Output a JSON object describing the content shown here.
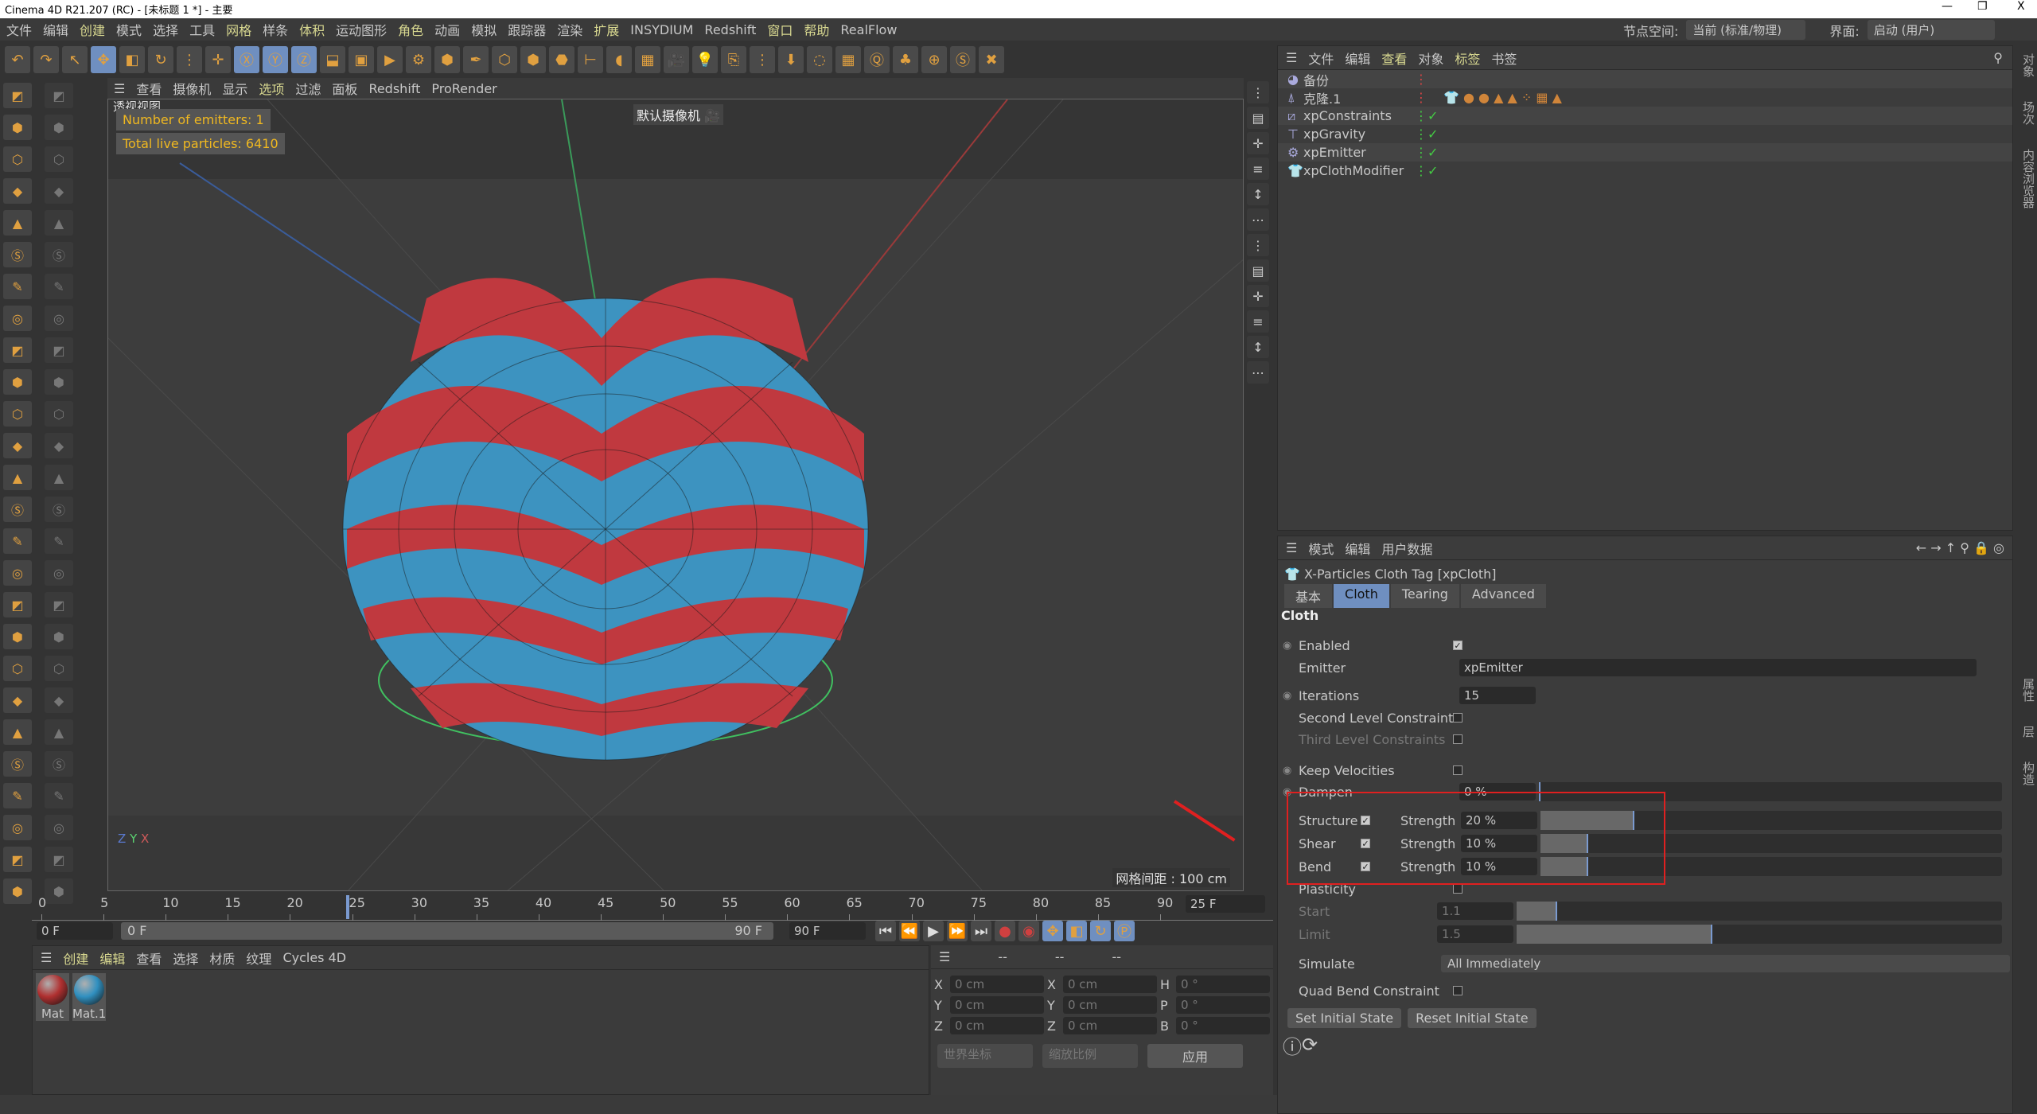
{
  "window": {
    "title": "Cinema 4D R21.207 (RC) - [未标题 1 *] - 主要",
    "minimize": "—",
    "maximize": "❐",
    "close": "X"
  },
  "menu": [
    "文件",
    "编辑",
    "创建",
    "模式",
    "选择",
    "工具",
    "网格",
    "样条",
    "体积",
    "运动图形",
    "角色",
    "动画",
    "模拟",
    "跟踪器",
    "渲染",
    "扩展",
    "INSYDIUM",
    "Redshift",
    "窗口",
    "帮助",
    "RealFlow"
  ],
  "node_space": {
    "label": "节点空间:",
    "value": "当前 (标准/物理)"
  },
  "layout": {
    "label": "界面:",
    "value": "启动 (用户)"
  },
  "viewport": {
    "menu": [
      "查看",
      "摄像机",
      "显示",
      "选项",
      "过滤",
      "面板",
      "Redshift",
      "ProRender"
    ],
    "view_name": "透视视图",
    "camera": "默认摄像机",
    "hud": {
      "emitters": "Number of emitters: 1",
      "particles": "Total live particles: 6410"
    },
    "grid_spacing": "网格间距 : 100 cm",
    "axis": {
      "x": "X",
      "y": "Y",
      "z": "Z"
    },
    "colors": {
      "red": "#c0393f",
      "blue": "#3d93c0"
    }
  },
  "timeline": {
    "ticks": [
      "0",
      "5",
      "10",
      "15",
      "20",
      "25",
      "30",
      "35",
      "40",
      "45",
      "50",
      "55",
      "60",
      "65",
      "70",
      "75",
      "80",
      "85",
      "90"
    ],
    "current_frame": "25 F",
    "start": "0 F",
    "range_start": "0 F",
    "range_end": "90 F",
    "end": "90 F",
    "playhead": 25
  },
  "materials": {
    "menu": [
      "创建",
      "编辑",
      "查看",
      "选择",
      "材质",
      "纹理",
      "Cycles 4D"
    ],
    "items": [
      {
        "name": "Mat",
        "color": "#b03030"
      },
      {
        "name": "Mat.1",
        "color": "#3090c0"
      }
    ]
  },
  "coords": {
    "head": [
      "--",
      "--",
      "--"
    ],
    "rows": [
      [
        "X",
        "0 cm",
        "X",
        "0 cm",
        "H",
        "0 °"
      ],
      [
        "Y",
        "0 cm",
        "Y",
        "0 cm",
        "P",
        "0 °"
      ],
      [
        "Z",
        "0 cm",
        "Z",
        "0 cm",
        "B",
        "0 °"
      ]
    ],
    "world": "世界坐标",
    "scale": "缩放比例",
    "apply": "应用"
  },
  "object_manager": {
    "menu": [
      "文件",
      "编辑",
      "查看",
      "对象",
      "标签",
      "书签"
    ],
    "objects": [
      "备份",
      "克隆.1",
      "xpConstraints",
      "xpGravity",
      "xpEmitter",
      "xpClothModifier"
    ]
  },
  "attributes": {
    "menu": [
      "模式",
      "编辑",
      "用户数据"
    ],
    "title": "X-Particles Cloth Tag [xpCloth]",
    "tabs": [
      "基本",
      "Cloth",
      "Tearing",
      "Advanced"
    ],
    "active_tab": "Cloth",
    "section": "Cloth",
    "enabled": {
      "label": "Enabled",
      "checked": true
    },
    "emitter": {
      "label": "Emitter",
      "value": "xpEmitter"
    },
    "iterations": {
      "label": "Iterations",
      "value": "15"
    },
    "second": {
      "label": "Second Level Constraints",
      "checked": false
    },
    "third": {
      "label": "Third Level Constraints",
      "checked": false
    },
    "keep": {
      "label": "Keep Velocities",
      "checked": false
    },
    "dampen": {
      "label": "Dampen",
      "value": "0 %",
      "percent": 0
    },
    "structure": {
      "label": "Structure",
      "strength_label": "Strength",
      "value": "20 %",
      "percent": 20,
      "checked": true
    },
    "shear": {
      "label": "Shear",
      "strength_label": "Strength",
      "value": "10 %",
      "percent": 10,
      "checked": true
    },
    "bend": {
      "label": "Bend",
      "strength_label": "Strength",
      "value": "10 %",
      "percent": 10,
      "checked": true
    },
    "plasticity": {
      "label": "Plasticity",
      "checked": false
    },
    "start": {
      "label": "Start",
      "value": "1.1"
    },
    "limit": {
      "label": "Limit",
      "value": "1.5"
    },
    "simulate": {
      "label": "Simulate",
      "value": "All Immediately"
    },
    "quad": {
      "label": "Quad Bend Constraint",
      "checked": false
    },
    "set_initial": "Set Initial State",
    "reset_initial": "Reset Initial State"
  },
  "right_tabs": [
    "对象",
    "场次",
    "内容浏览器",
    "属性",
    "层",
    "构造"
  ],
  "highlight_color": "#e02020"
}
